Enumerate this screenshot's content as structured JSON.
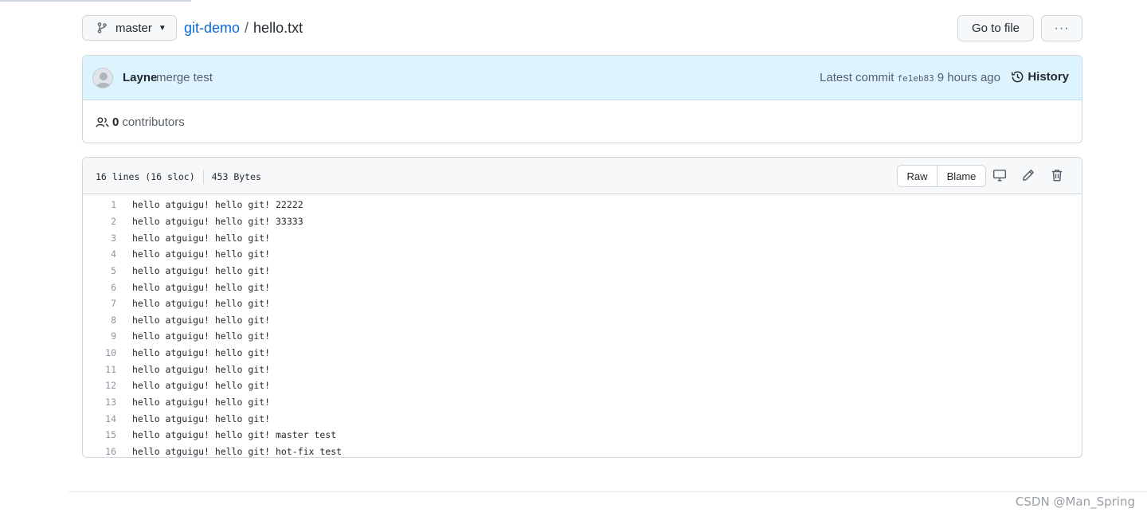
{
  "header": {
    "branch": "master",
    "repo": "git-demo",
    "separator": "/",
    "filename": "hello.txt",
    "goto_label": "Go to file",
    "more_label": "···"
  },
  "commit": {
    "author": "Layne",
    "message": "merge test",
    "latest_label": "Latest commit",
    "sha": "fe1eb83",
    "time": "9 hours ago",
    "history_label": "History"
  },
  "contributors": {
    "count": "0",
    "label": "contributors"
  },
  "file": {
    "lines_info": "16 lines (16 sloc)",
    "size": "453 Bytes",
    "raw_label": "Raw",
    "blame_label": "Blame",
    "lines": [
      {
        "n": "1",
        "text": "hello atguigu! hello git! 22222"
      },
      {
        "n": "2",
        "text": "hello atguigu! hello git! 33333"
      },
      {
        "n": "3",
        "text": "hello atguigu! hello git!"
      },
      {
        "n": "4",
        "text": "hello atguigu! hello git!"
      },
      {
        "n": "5",
        "text": "hello atguigu! hello git!"
      },
      {
        "n": "6",
        "text": "hello atguigu! hello git!"
      },
      {
        "n": "7",
        "text": "hello atguigu! hello git!"
      },
      {
        "n": "8",
        "text": "hello atguigu! hello git!"
      },
      {
        "n": "9",
        "text": "hello atguigu! hello git!"
      },
      {
        "n": "10",
        "text": "hello atguigu! hello git!"
      },
      {
        "n": "11",
        "text": "hello atguigu! hello git!"
      },
      {
        "n": "12",
        "text": "hello atguigu! hello git!"
      },
      {
        "n": "13",
        "text": "hello atguigu! hello git!"
      },
      {
        "n": "14",
        "text": "hello atguigu! hello git!"
      },
      {
        "n": "15",
        "text": "hello atguigu! hello git! master test"
      },
      {
        "n": "16",
        "text": "hello atguigu! hello git! hot-fix test"
      }
    ]
  },
  "watermark": "CSDN @Man_Spring",
  "colors": {
    "link": "#0969da",
    "commit_bg": "#ddf4ff",
    "header_bg": "#f6f8fa",
    "border": "#d0d7de"
  }
}
